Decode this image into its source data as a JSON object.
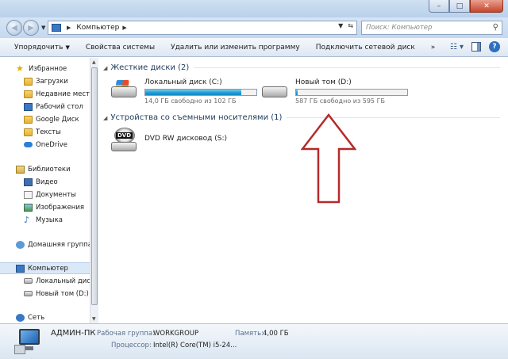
{
  "window": {
    "controls": {
      "minimize": "–",
      "maximize": "□",
      "close": "✕"
    }
  },
  "address": {
    "back": "◀",
    "forward": "▶",
    "path": "Компьютер",
    "search_placeholder": "Поиск: Компьютер"
  },
  "toolbar": {
    "organize": "Упорядочить",
    "system_properties": "Свойства системы",
    "uninstall": "Удалить или изменить программу",
    "map_drive": "Подключить сетевой диск",
    "more": "»"
  },
  "nav": {
    "favorites": "Избранное",
    "downloads": "Загрузки",
    "recent": "Недавние места",
    "desktop": "Рабочий стол",
    "google_drive": "Google Диск",
    "texts": "Тексты",
    "onedrive": "OneDrive",
    "libraries": "Библиотеки",
    "video": "Видео",
    "documents": "Документы",
    "images": "Изображения",
    "music": "Музыка",
    "homegroup": "Домашняя группа",
    "computer": "Компьютер",
    "local_disk": "Локальный диск",
    "new_volume": "Новый том (D:)",
    "network": "Сеть"
  },
  "content": {
    "hard_drives_header": "Жесткие диски (2)",
    "removable_header": "Устройства со съемными носителями (1)",
    "drives": [
      {
        "name": "Локальный диск (C:)",
        "free": "14,0 ГБ свободно из 102 ГБ",
        "used_fraction": 0.863
      },
      {
        "name": "Новый том (D:)",
        "free": "587 ГБ свободно из 595 ГБ",
        "used_fraction": 0.013
      }
    ],
    "dvd": {
      "name": "DVD RW дисковод (S:)",
      "label": "DVD"
    }
  },
  "details": {
    "computer_name": "АДМИН-ПК",
    "workgroup_label": "Рабочая группа:",
    "workgroup_value": "WORKGROUP",
    "memory_label": "Память:",
    "memory_value": "4,00 ГБ",
    "cpu_label": "Процессор:",
    "cpu_value": "Intel(R) Core(TM) i5-24..."
  },
  "colors": {
    "arrow": "#b52a2a",
    "progress": "#26a0da"
  }
}
